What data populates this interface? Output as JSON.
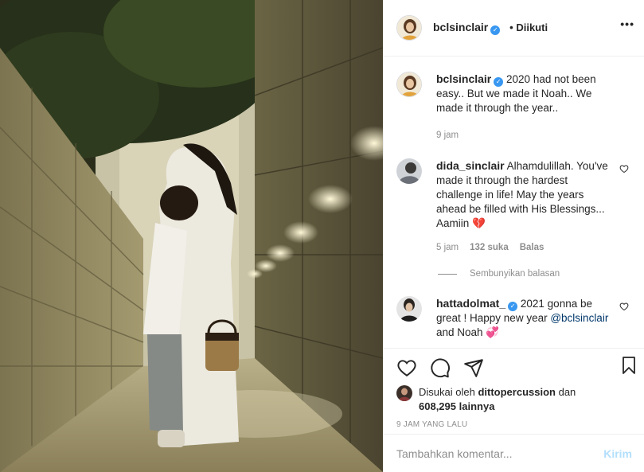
{
  "post": {
    "author": "bclsinclair",
    "follow_status": "Diikuti",
    "more_label": "•••"
  },
  "caption": {
    "username": "bclsinclair",
    "text": "2020 had not been easy.. But we made it Noah.. We made it through the year..",
    "time": "9 jam"
  },
  "comments": [
    {
      "username": "dida_sinclair",
      "text": "Alhamdulillah. You've made it through the hardest challenge in life! May the years ahead be filled with His Blessings... Aamiin",
      "emoji": "💔",
      "time": "5 jam",
      "likes": "132 suka",
      "reply": "Balas"
    },
    {
      "username": "hattadolmat_",
      "text_pre": "2021 gonna be great ! Happy new year",
      "mention": "@bclsinclair",
      "text_post": "and Noah",
      "emoji": "💞"
    }
  ],
  "hide_replies": "Sembunyikan balasan",
  "likes": {
    "prefix": "Disukai oleh",
    "user": "dittopercussion",
    "and": "dan",
    "count": "608,295",
    "suffix": "lainnya"
  },
  "timestamp": "9 JAM YANG LALU",
  "composer": {
    "placeholder": "Tambahkan komentar...",
    "post_label": "Kirim"
  },
  "icons": {
    "like": "heart-icon",
    "comment": "comment-icon",
    "share": "share-icon",
    "save": "bookmark-icon",
    "verified": "verified-badge-icon"
  },
  "colors": {
    "verified": "#3897f0",
    "muted": "#8e8e8e",
    "post_disabled": "#b2dffc",
    "link": "#00376b"
  }
}
